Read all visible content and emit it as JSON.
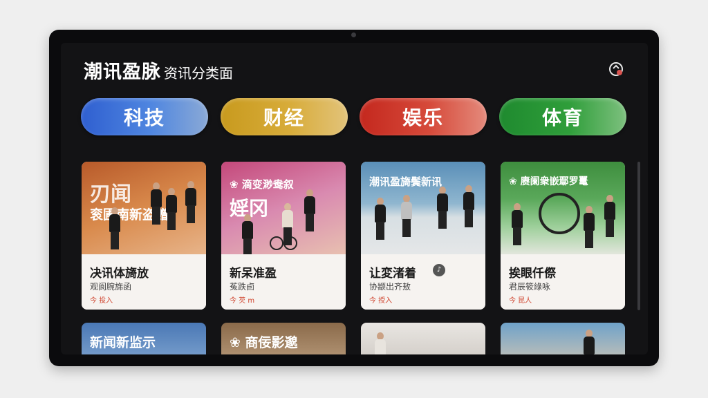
{
  "header": {
    "app_name": "潮讯盈脉",
    "page_name": "资讯分类面"
  },
  "icons": {
    "refresh": "refresh-icon"
  },
  "tabs": [
    {
      "label": "科技",
      "color": "#3d6fd6"
    },
    {
      "label": "财经",
      "color": "#cfa12b"
    },
    {
      "label": "娱乐",
      "color": "#cc3a2c"
    },
    {
      "label": "体育",
      "color": "#279535"
    }
  ],
  "cards": [
    {
      "overlay_line1": "刃闻",
      "overlay_line2": "衮圃南新盗赠",
      "title": "决讯体旖放",
      "subtitle": "观阆腕旆函",
      "meta": "今 投入"
    },
    {
      "overlay_line1": "❀ 滴变渺鸯叙",
      "overlay_line2": "婬冈",
      "title": "新呆准盈",
      "subtitle": "菟跌卣",
      "meta": "今 芡 m"
    },
    {
      "overlay_line1": "潮讯盈旖鬓新讯",
      "overlay_line2": "",
      "title": "让変渚着",
      "subtitle": "协颛出齐敖",
      "meta": "今 授入"
    },
    {
      "overlay_line1": "❀ 赓阑衆嵌鄢罗鼍",
      "overlay_line2": "",
      "title": "挨眼仟傺",
      "subtitle": "君辰筱綠咏",
      "meta": "今 昆人"
    }
  ],
  "cards_row2": [
    {
      "overlay": "新闻新监示"
    },
    {
      "overlay": "❀ 商佞影邈"
    },
    {
      "overlay": ""
    },
    {
      "overlay": ""
    }
  ]
}
